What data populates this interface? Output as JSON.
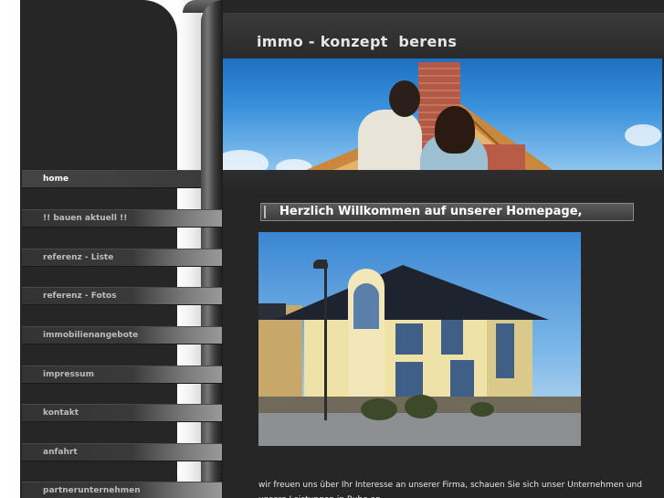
{
  "site": {
    "title": "immo - konzept  berens"
  },
  "nav": {
    "items": [
      {
        "label": "home"
      },
      {
        "label": "!! bauen aktuell !!"
      },
      {
        "label": "referenz - Liste"
      },
      {
        "label": "referenz - Fotos"
      },
      {
        "label": "immobilienangebote"
      },
      {
        "label": "impressum"
      },
      {
        "label": "kontakt"
      },
      {
        "label": "anfahrt"
      },
      {
        "label": "partnerunternehmen"
      }
    ]
  },
  "content": {
    "welcome_heading": "Herzlich Willkommen auf unserer Homepage,",
    "intro_text": "wir freuen uns über Ihr Interesse an unserer Firma, schauen Sie sich unser Unternehmen und unsere Leistungen in Ruhe an."
  },
  "colors": {
    "background": "#262626",
    "nav_text": "#bdbdbd",
    "active_nav_text": "#ffffff",
    "title_text": "#e6e6e6"
  }
}
